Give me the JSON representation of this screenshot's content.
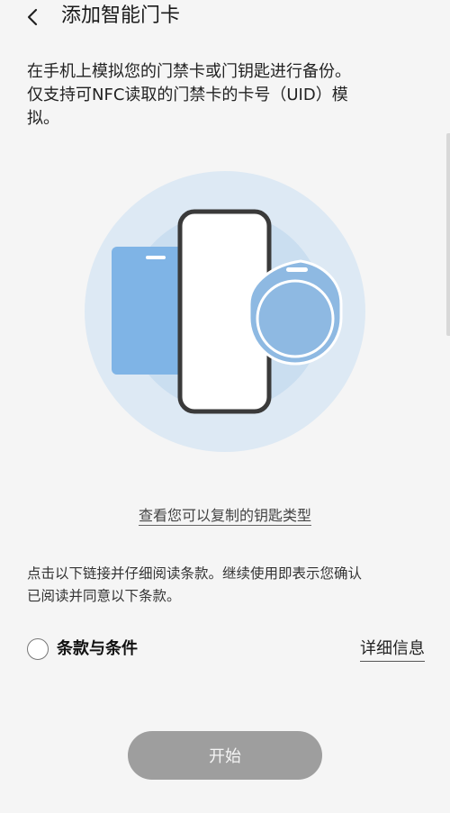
{
  "header": {
    "title": "添加智能门卡"
  },
  "intro": {
    "line1": "在手机上模拟您的门禁卡或门钥匙进行备份。",
    "line2": "仅支持可NFC读取的门禁卡的卡号（UID）模",
    "line3": "拟。"
  },
  "links": {
    "key_types": "查看您可以复制的钥匙类型"
  },
  "terms": {
    "notice_line1": "点击以下链接并仔细阅读条款。继续使用即表示您确认",
    "notice_line2": "已阅读并同意以下条款。",
    "checkbox_label": "条款与条件",
    "details_link": "详细信息",
    "accepted": false
  },
  "actions": {
    "start_label": "开始"
  },
  "colors": {
    "circle_outer": "#dde9f4",
    "circle_inner": "#cadef0",
    "card_blue": "#7fb4e6",
    "phone_frame": "#3a3a3a",
    "fob_blue": "#8eb9e2",
    "button_disabled": "#9e9e9e"
  }
}
